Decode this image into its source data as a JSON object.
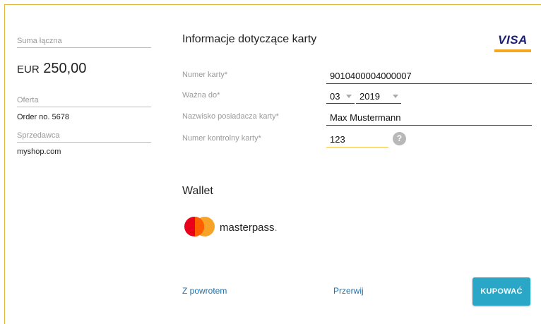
{
  "summary": {
    "total_label": "Suma łączna",
    "currency": "EUR",
    "amount": "250,00",
    "offer_label": "Oferta",
    "offer_value": "Order no. 5678",
    "seller_label": "Sprzedawca",
    "seller_value": "myshop.com"
  },
  "card": {
    "title": "Informacje dotyczące karty",
    "brand_logo_text": "VISA",
    "number_label": "Numer karty*",
    "number_value": "9010400004000007",
    "expiry_label": "Ważna do*",
    "expiry_month": "03",
    "expiry_year": "2019",
    "holder_label": "Nazwisko posiadacza karty*",
    "holder_value": "Max Mustermann",
    "cvc_label": "Numer kontrolny karty*",
    "cvc_value": "123",
    "help_glyph": "?"
  },
  "wallet": {
    "title": "Wallet",
    "masterpass_text": "masterpass",
    "masterpass_dot": "."
  },
  "actions": {
    "back_label": "Z powrotem",
    "cancel_label": "Przerwij",
    "buy_label": "KUPOWAĆ"
  },
  "colors": {
    "accent_border": "#e0b73a",
    "buy_button": "#2aa7c6",
    "link": "#1f6fa8"
  }
}
